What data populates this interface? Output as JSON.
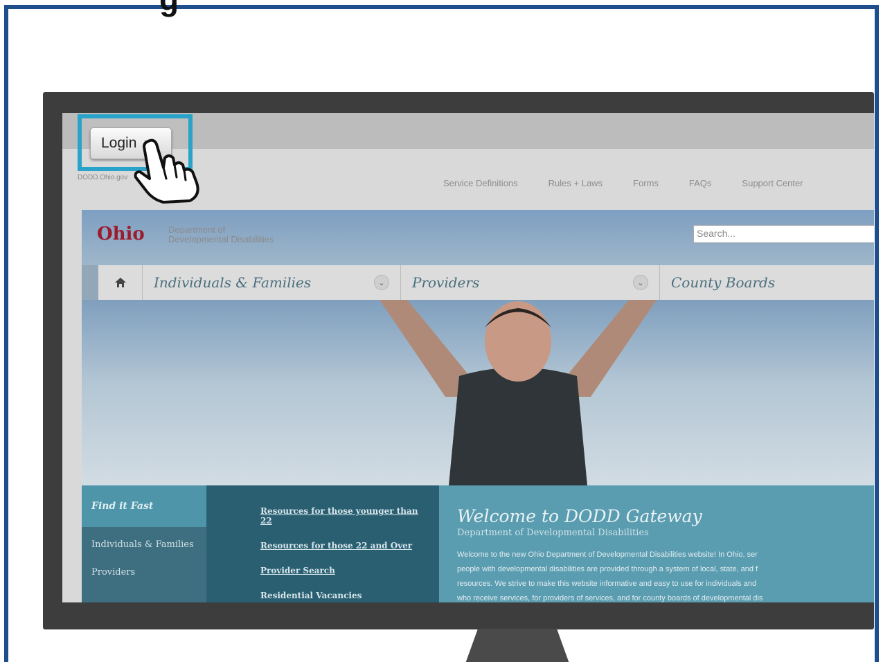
{
  "page": {
    "title_partial": "g"
  },
  "login": {
    "label": "Login",
    "chevron": "›"
  },
  "site": {
    "url_text": "DODD.Ohio.gov",
    "top_links": [
      "Service Definitions",
      "Rules + Laws",
      "Forms",
      "FAQs",
      "Support Center"
    ],
    "logo": "Ohio",
    "dept_line1": "Department of",
    "dept_line2": "Developmental Disabilities",
    "search_placeholder": "Search...",
    "nav": {
      "home_icon": "home-icon",
      "items": [
        "Individuals & Families",
        "Providers",
        "County Boards"
      ]
    },
    "find_fast": "Find it Fast",
    "side_items": [
      "Individuals & Families",
      "Providers"
    ],
    "resource_links": [
      "Resources for those younger than 22",
      "Resources for those 22 and Over",
      "Provider Search",
      "Residential Vacancies"
    ],
    "welcome_title": "Welcome to DODD Gateway",
    "welcome_sub": "Department of Developmental Disabilities",
    "welcome_lines": [
      "Welcome to the new Ohio Department of Developmental Disabilities website! In Ohio, ser",
      "people with developmental disabilities are provided through a system of local, state, and f",
      "resources. We strive to make this website informative and easy to use for individuals and",
      "who receive services, for providers of services, and for county boards of developmental dis"
    ]
  }
}
